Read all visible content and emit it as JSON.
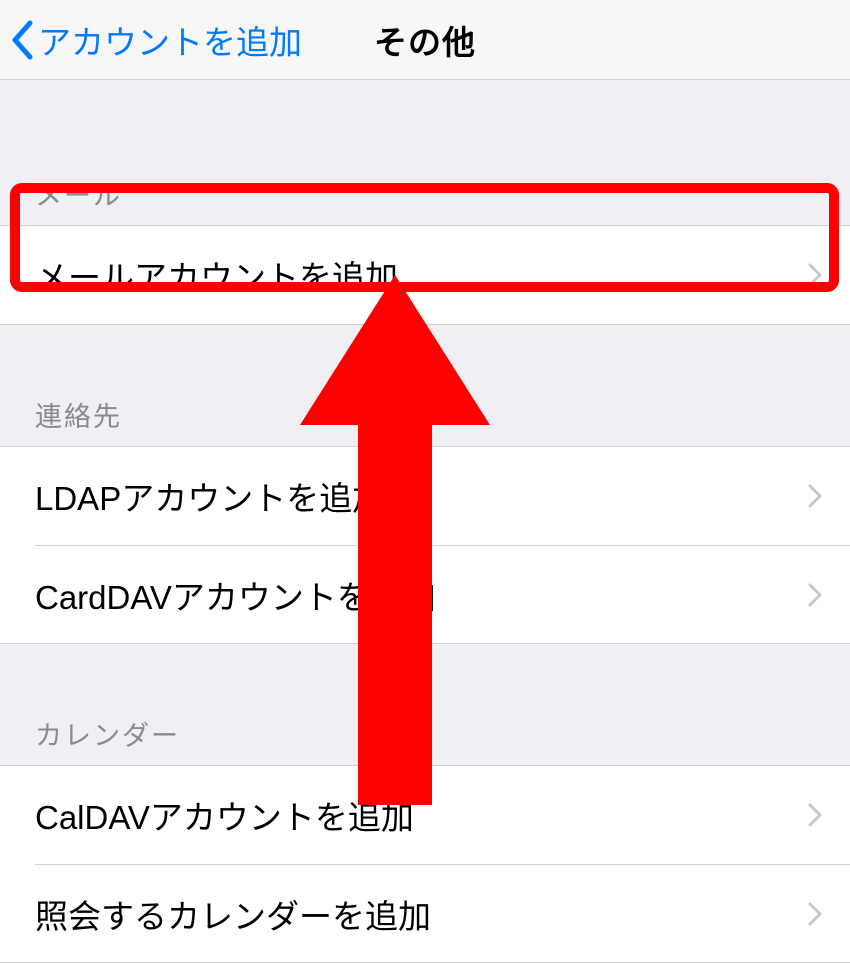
{
  "nav": {
    "back_label": "アカウントを追加",
    "title": "その他"
  },
  "sections": {
    "mail": {
      "header": "メール",
      "items": [
        {
          "label": "メールアカウントを追加"
        }
      ]
    },
    "contacts": {
      "header": "連絡先",
      "items": [
        {
          "label": "LDAPアカウントを追加"
        },
        {
          "label": "CardDAVアカウントを追加"
        }
      ]
    },
    "calendar": {
      "header": "カレンダー",
      "items": [
        {
          "label": "CalDAVアカウントを追加"
        },
        {
          "label": "照会するカレンダーを追加"
        }
      ]
    }
  },
  "annotation": {
    "highlight_color": "#fd0000",
    "arrow_color": "#fd0000"
  }
}
